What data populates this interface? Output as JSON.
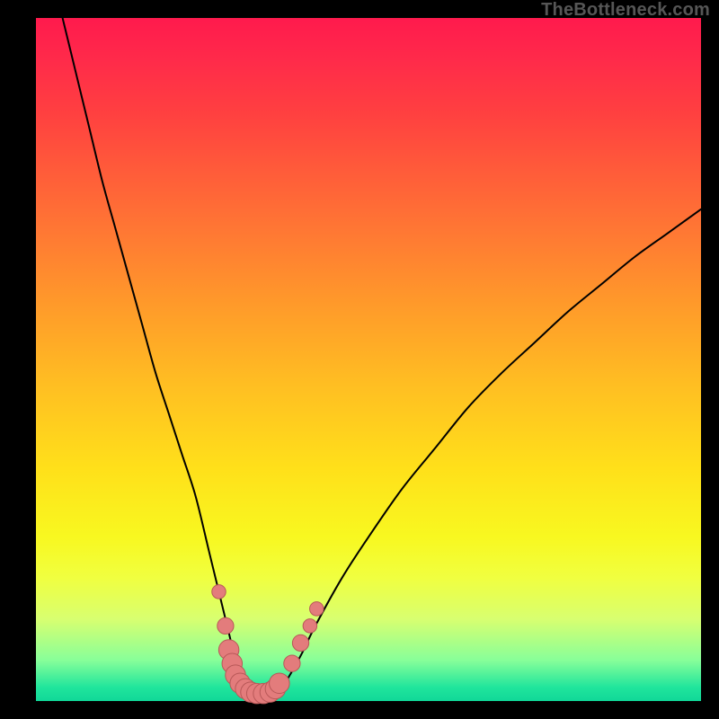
{
  "watermark": "TheBottleneck.com",
  "colors": {
    "curve": "#000000",
    "marker_fill": "#e37c7c",
    "marker_stroke": "#b85858",
    "gradient_top": "#ff1a4d",
    "gradient_bottom": "#10d898",
    "frame": "#000000"
  },
  "chart_data": {
    "type": "line",
    "title": "",
    "xlabel": "",
    "ylabel": "",
    "xlim": [
      0,
      100
    ],
    "ylim": [
      0,
      100
    ],
    "grid": false,
    "legend": false,
    "series": [
      {
        "name": "bottleneck-curve",
        "x": [
          4,
          6,
          8,
          10,
          12,
          14,
          16,
          18,
          20,
          22,
          24,
          26,
          27,
          28,
          29,
          30,
          31,
          32,
          33,
          34,
          35,
          36,
          37,
          38,
          40,
          42,
          46,
          50,
          55,
          60,
          65,
          70,
          75,
          80,
          85,
          90,
          95,
          100
        ],
        "y": [
          100,
          92,
          84,
          76,
          69,
          62,
          55,
          48,
          42,
          36,
          30,
          22,
          18,
          14,
          10,
          6,
          3.5,
          2,
          1.2,
          1,
          1,
          1.2,
          2,
          3.5,
          7,
          11,
          18,
          24,
          31,
          37,
          43,
          48,
          52.5,
          57,
          61,
          65,
          68.5,
          72
        ]
      }
    ],
    "markers": [
      {
        "x": 27.5,
        "y": 16,
        "r": 1.1
      },
      {
        "x": 28.5,
        "y": 11,
        "r": 1.3
      },
      {
        "x": 29.0,
        "y": 7.5,
        "r": 1.6
      },
      {
        "x": 29.5,
        "y": 5.5,
        "r": 1.6
      },
      {
        "x": 30.0,
        "y": 3.8,
        "r": 1.6
      },
      {
        "x": 30.7,
        "y": 2.6,
        "r": 1.6
      },
      {
        "x": 31.5,
        "y": 1.8,
        "r": 1.6
      },
      {
        "x": 32.3,
        "y": 1.3,
        "r": 1.6
      },
      {
        "x": 33.2,
        "y": 1.1,
        "r": 1.6
      },
      {
        "x": 34.2,
        "y": 1.1,
        "r": 1.6
      },
      {
        "x": 35.2,
        "y": 1.3,
        "r": 1.6
      },
      {
        "x": 36.0,
        "y": 1.8,
        "r": 1.6
      },
      {
        "x": 36.6,
        "y": 2.6,
        "r": 1.6
      },
      {
        "x": 38.5,
        "y": 5.5,
        "r": 1.3
      },
      {
        "x": 39.8,
        "y": 8.5,
        "r": 1.3
      },
      {
        "x": 41.2,
        "y": 11,
        "r": 1.1
      },
      {
        "x": 42.2,
        "y": 13.5,
        "r": 1.1
      }
    ]
  }
}
